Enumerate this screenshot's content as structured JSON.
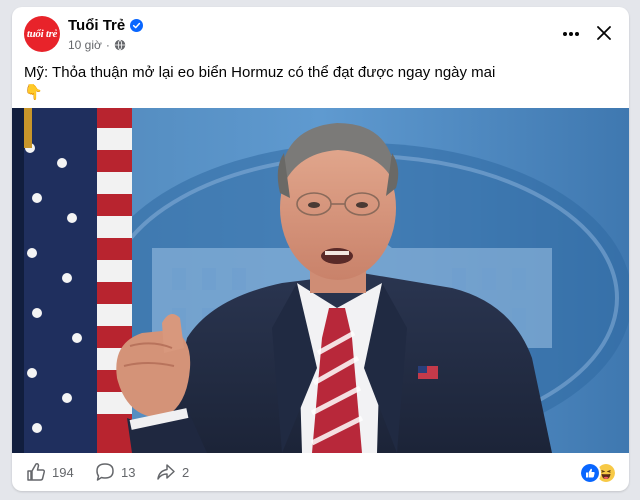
{
  "post": {
    "page_name": "Tuổi Trẻ",
    "logo_text": "tuổi trẻ",
    "time": "10 giờ",
    "separator": "·",
    "privacy_icon": "globe-icon",
    "caption_line1": "Mỹ: Thỏa thuận mở lại eo biển Hormuz có thể đạt được ngay ngày mai",
    "caption_line2": "👇"
  },
  "stats": {
    "likes": "194",
    "comments": "13",
    "shares": "2"
  },
  "icons": {
    "verified": "verified-badge-icon",
    "more": "more-dots-icon",
    "close": "close-icon",
    "like": "thumbs-up-icon",
    "comment": "comment-bubble-icon",
    "share": "share-arrow-icon",
    "reactions": [
      "like-reaction-icon",
      "haha-reaction-icon"
    ]
  },
  "colors": {
    "brand_red": "#e8232a",
    "verified_blue": "#0866ff",
    "muted_text": "#65676b"
  }
}
